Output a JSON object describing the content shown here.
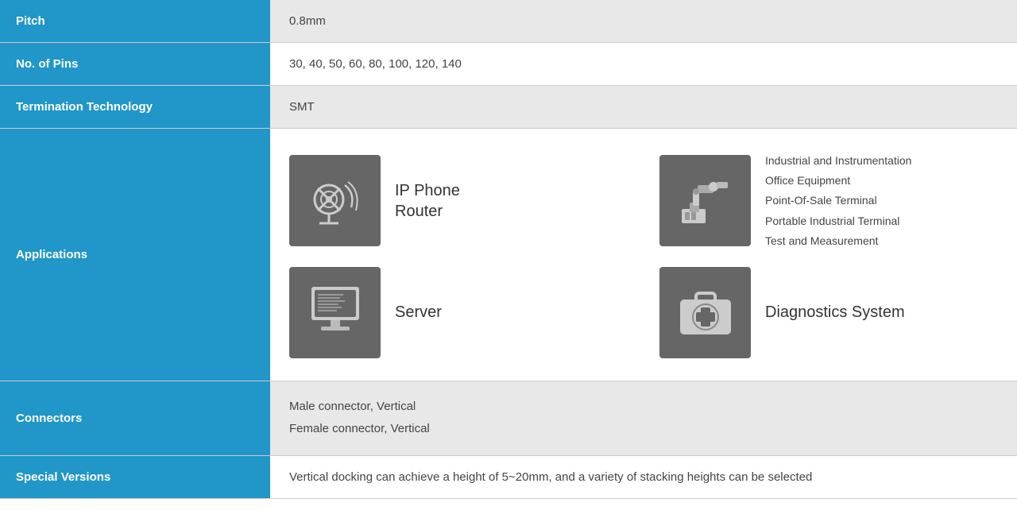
{
  "rows": [
    {
      "id": "pitch",
      "label": "Pitch",
      "value": "0.8mm",
      "type": "text"
    },
    {
      "id": "no-of-pins",
      "label": "No. of Pins",
      "value": "30, 40, 50, 60, 80, 100, 120, 140",
      "type": "text"
    },
    {
      "id": "termination",
      "label": "Termination Technology",
      "value": "SMT",
      "type": "text"
    },
    {
      "id": "applications",
      "label": "Applications",
      "type": "applications"
    },
    {
      "id": "connectors",
      "label": "Connectors",
      "value": "Male connector, Vertical\nFemale connector, Vertical",
      "type": "text"
    },
    {
      "id": "special",
      "label": "Special Versions",
      "value": "Vertical docking can achieve a height of 5~20mm, and a variety of stacking heights can be selected",
      "type": "text"
    }
  ],
  "applications": {
    "items": [
      {
        "id": "phone-router",
        "label": "IP Phone\nRouter",
        "icon": "satellite"
      },
      {
        "id": "industrial",
        "lines": [
          "Industrial and Instrumentation",
          "Office Equipment",
          "Point-Of-Sale Terminal",
          "Portable Industrial Terminal",
          "Test and Measurement"
        ],
        "icon": "robot-arm"
      },
      {
        "id": "server",
        "label": "Server",
        "icon": "server"
      },
      {
        "id": "diagnostics",
        "label": "Diagnostics System",
        "icon": "medkit"
      }
    ]
  }
}
